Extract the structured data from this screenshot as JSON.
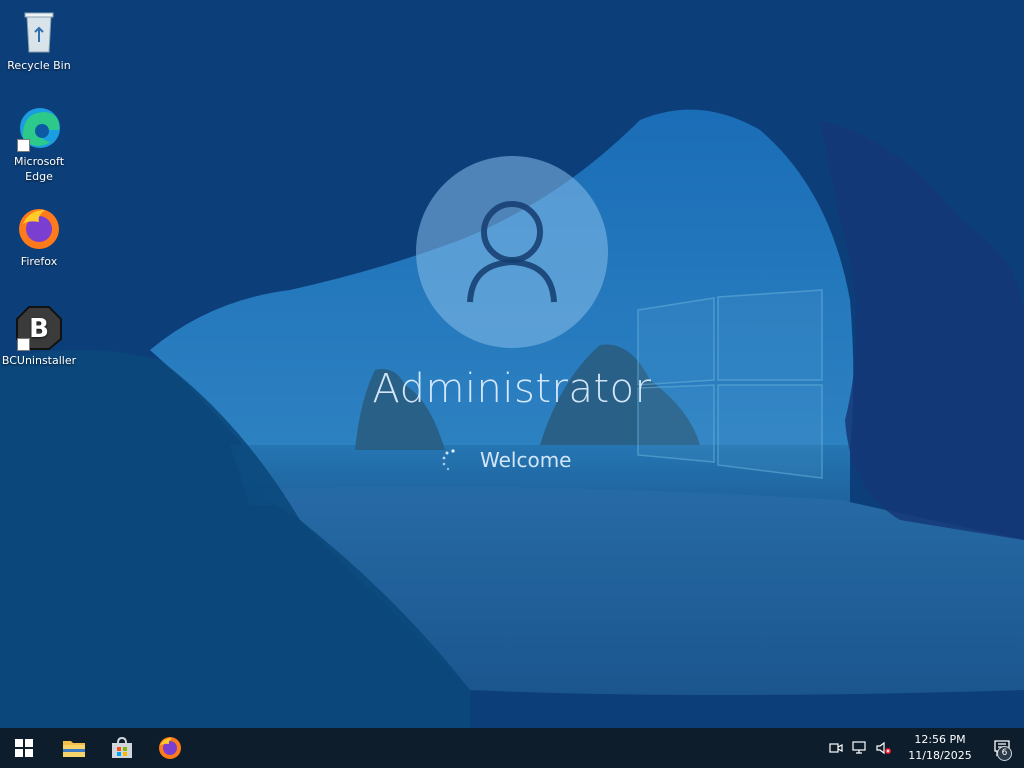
{
  "desktop": {
    "icons": [
      {
        "label": "Recycle Bin",
        "icon": "recycle-bin-icon"
      },
      {
        "label": "Microsoft\nEdge",
        "icon": "edge-icon"
      },
      {
        "label": "Firefox",
        "icon": "firefox-icon"
      },
      {
        "label": "BCUninstaller",
        "icon": "bcuninstaller-icon"
      }
    ]
  },
  "login": {
    "username": "Administrator",
    "status": "Welcome",
    "avatar_icon": "user-avatar-icon",
    "spinner_icon": "loading-spinner-icon"
  },
  "taskbar": {
    "start_icon": "windows-start-icon",
    "pinned": [
      {
        "name": "file-explorer",
        "icon": "folder-icon"
      },
      {
        "name": "microsoft-store",
        "icon": "store-icon"
      },
      {
        "name": "firefox",
        "icon": "firefox-icon"
      }
    ],
    "tray": {
      "icons": [
        "meet-now-icon",
        "network-icon",
        "volume-muted-icon"
      ],
      "time": "12:56 PM",
      "date": "11/18/2025",
      "notification_count": "6"
    }
  },
  "colors": {
    "taskbar": "#0e1d2b",
    "overlay_text": "#e1f0ff",
    "wallpaper_base": "#0b5b96"
  }
}
